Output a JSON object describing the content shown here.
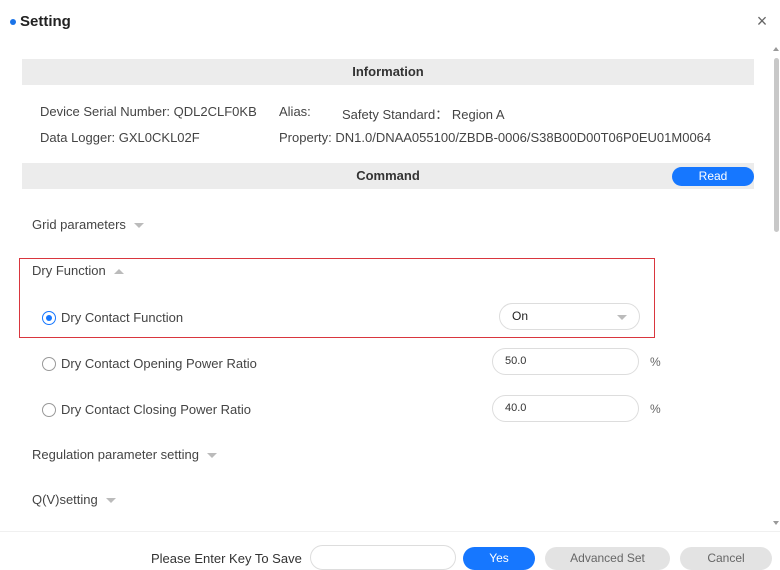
{
  "dialog": {
    "title": "Setting",
    "close": "×"
  },
  "information": {
    "header": "Information",
    "serial": "Device Serial Number: QDL2CLF0KB",
    "alias": "Alias:",
    "safety": "Safety Standard： Region A",
    "logger": "Data Logger: GXL0CKL02F",
    "property": "Property: DN1.0/DNAA055100/ZBDB-0006/S38B00D00T06P0EU01M0064"
  },
  "command": {
    "header": "Command",
    "read_label": "Read"
  },
  "sections": {
    "grid": "Grid parameters",
    "dry": "Dry Function",
    "regulation": "Regulation parameter setting",
    "qv": "Q(V)setting"
  },
  "dry_function": {
    "contact": {
      "label": "Dry Contact Function",
      "value": "On",
      "checked": true
    },
    "opening": {
      "label": "Dry Contact Opening Power Ratio",
      "value": "50.0",
      "unit": "%",
      "checked": false
    },
    "closing": {
      "label": "Dry Contact Closing Power Ratio",
      "value": "40.0",
      "unit": "%",
      "checked": false
    }
  },
  "footer": {
    "save_label": "Please Enter Key To Save",
    "key_value": "",
    "yes": "Yes",
    "advanced": "Advanced Set",
    "cancel": "Cancel"
  },
  "colors": {
    "accent": "#1677ff",
    "highlight": "#d9363e"
  }
}
